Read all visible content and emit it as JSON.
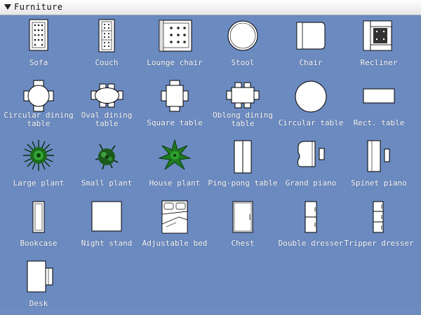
{
  "header": {
    "title": "Furniture"
  },
  "items": [
    {
      "label": "Sofa",
      "icon": "sofa-icon"
    },
    {
      "label": "Couch",
      "icon": "couch-icon"
    },
    {
      "label": "Lounge chair",
      "icon": "lounge-chair-icon"
    },
    {
      "label": "Stool",
      "icon": "stool-icon"
    },
    {
      "label": "Chair",
      "icon": "chair-icon"
    },
    {
      "label": "Recliner",
      "icon": "recliner-icon"
    },
    {
      "label": "Circular dining table",
      "icon": "circular-dining-table-icon"
    },
    {
      "label": "Oval dining table",
      "icon": "oval-dining-table-icon"
    },
    {
      "label": "Square table",
      "icon": "square-table-icon"
    },
    {
      "label": "Oblong dining table",
      "icon": "oblong-dining-table-icon"
    },
    {
      "label": "Circular table",
      "icon": "circular-table-icon"
    },
    {
      "label": "Rect. table",
      "icon": "rect-table-icon"
    },
    {
      "label": "Large plant",
      "icon": "large-plant-icon"
    },
    {
      "label": "Small plant",
      "icon": "small-plant-icon"
    },
    {
      "label": "House plant",
      "icon": "house-plant-icon"
    },
    {
      "label": "Ping-pong table",
      "icon": "ping-pong-table-icon"
    },
    {
      "label": "Grand piano",
      "icon": "grand-piano-icon"
    },
    {
      "label": "Spinet piano",
      "icon": "spinet-piano-icon"
    },
    {
      "label": "Bookcase",
      "icon": "bookcase-icon"
    },
    {
      "label": "Night stand",
      "icon": "night-stand-icon"
    },
    {
      "label": "Adjustable bed",
      "icon": "adjustable-bed-icon"
    },
    {
      "label": "Chest",
      "icon": "chest-icon"
    },
    {
      "label": "Double dresser",
      "icon": "double-dresser-icon"
    },
    {
      "label": "Tripper dresser",
      "icon": "tripper-dresser-icon"
    },
    {
      "label": "Desk",
      "icon": "desk-icon"
    }
  ]
}
